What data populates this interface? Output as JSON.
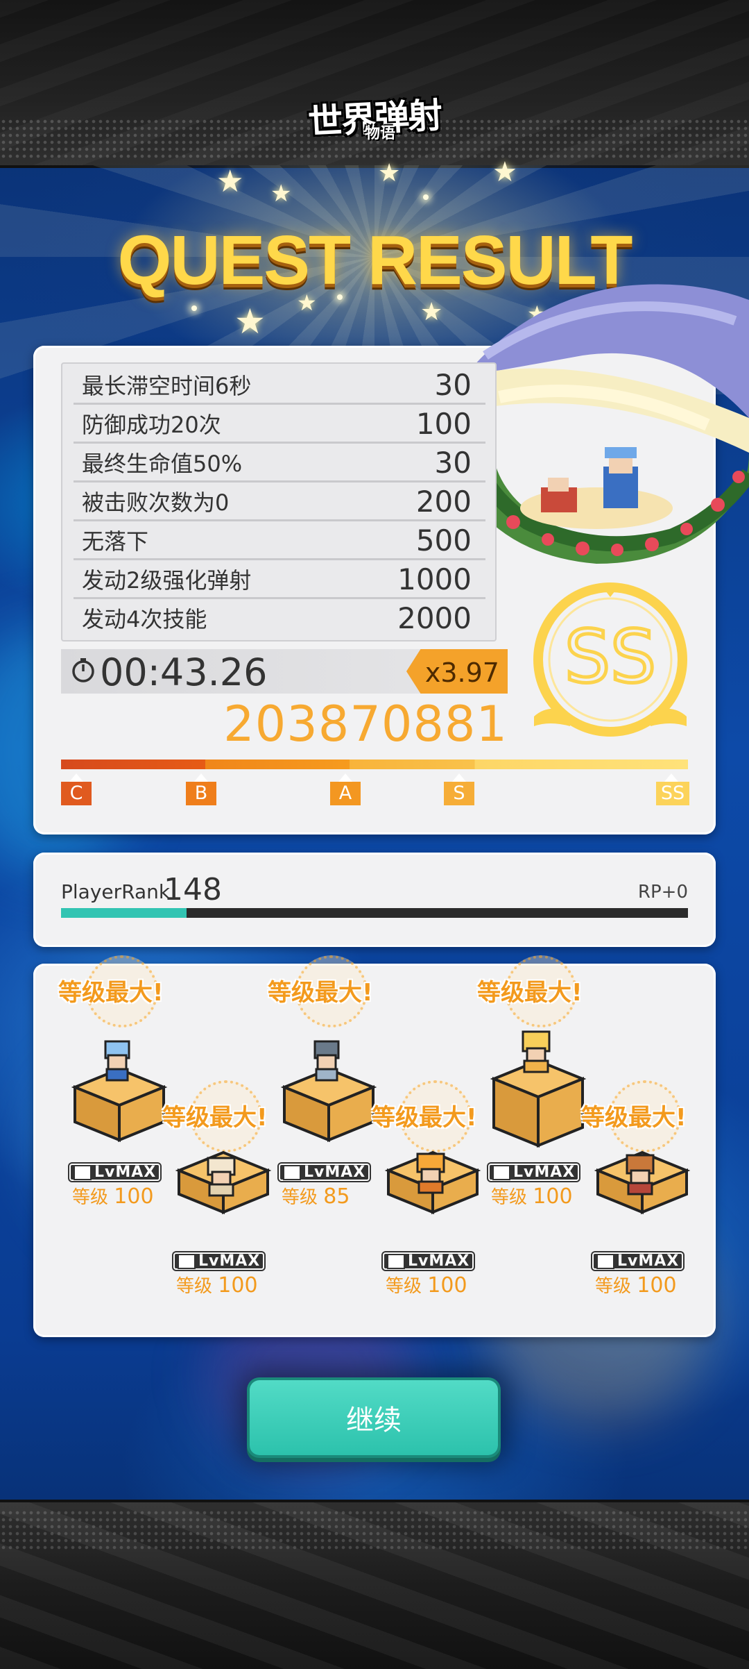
{
  "header": {
    "logo_main": "世界弹射",
    "logo_sub": "物语"
  },
  "title": "QUEST RESULT",
  "missions": [
    {
      "label": "最长滞空时间6秒",
      "points": "30"
    },
    {
      "label": "防御成功20次",
      "points": "100"
    },
    {
      "label": "最终生命值50%",
      "points": "30"
    },
    {
      "label": "被击败次数为0",
      "points": "200"
    },
    {
      "label": "无落下",
      "points": "500"
    },
    {
      "label": "发动2级强化弹射",
      "points": "1000"
    },
    {
      "label": "发动4次技能",
      "points": "2000"
    }
  ],
  "result": {
    "time": "00:43.26",
    "multiplier": "x3.97",
    "score": "203870881",
    "grade": "SS",
    "rank_labels": [
      "C",
      "B",
      "A",
      "S",
      "SS"
    ]
  },
  "player": {
    "rank_label": "PlayerRank",
    "rank_value": "148",
    "rp": "RP+0",
    "progress_fraction": 0.2
  },
  "units": [
    {
      "max_text": "等级最大!",
      "lv_badge": "LvMAX",
      "level_label": "等级",
      "level": "100"
    },
    {
      "max_text": "等级最大!",
      "lv_badge": "LvMAX",
      "level_label": "等级",
      "level": "100"
    },
    {
      "max_text": "等级最大!",
      "lv_badge": "LvMAX",
      "level_label": "等级",
      "level": "85"
    },
    {
      "max_text": "等级最大!",
      "lv_badge": "LvMAX",
      "level_label": "等级",
      "level": "100"
    },
    {
      "max_text": "等级最大!",
      "lv_badge": "LvMAX",
      "level_label": "等级",
      "level": "100"
    },
    {
      "max_text": "等级最大!",
      "lv_badge": "LvMAX",
      "level_label": "等级",
      "level": "100"
    }
  ],
  "continue_label": "继续",
  "colors": {
    "accent": "#f7a931",
    "teal": "#32c4b2",
    "gold": "#ffd84a"
  }
}
